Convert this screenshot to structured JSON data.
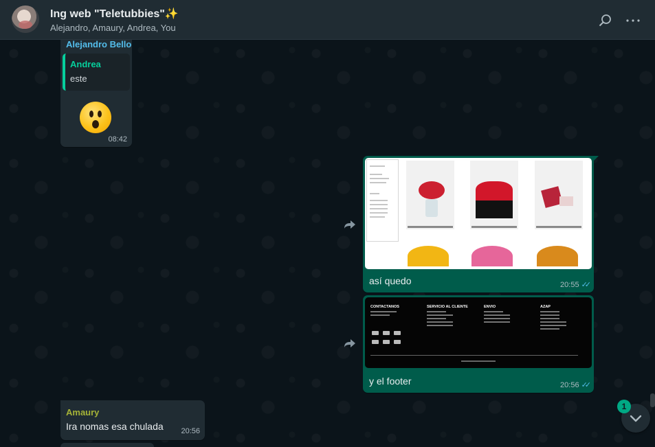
{
  "header": {
    "title": "Ing web \"Teletubbies\"",
    "title_emoji": "✨",
    "participants": "Alejandro, Amaury, Andrea, You",
    "icons": [
      "search-icon",
      "menu-icon"
    ]
  },
  "messages": [
    {
      "sender": "Alejandro Bello",
      "quoted_sender": "Andrea",
      "quoted_text": "este",
      "emoji": "😮",
      "time": "08:42"
    },
    {
      "caption": "así quedo",
      "time": "20:55",
      "status": "read"
    },
    {
      "caption": "y el footer",
      "time": "20:56",
      "status": "read",
      "footer_headings": [
        "CONTACTANOS",
        "SERVICIO AL CLIENTE",
        "ENVIO",
        "AZAP"
      ]
    },
    {
      "sender": "Amaury",
      "text": "Ira nomas esa chulada",
      "time": "20:56"
    }
  ],
  "unread_count": "1",
  "colors": {
    "header_bg": "#202c33",
    "chat_bg": "#0b141a",
    "incoming_bubble": "#202c33",
    "outgoing_bubble": "#005c4b",
    "read_ticks": "#53bdeb",
    "unread_badge": "#00a884"
  }
}
